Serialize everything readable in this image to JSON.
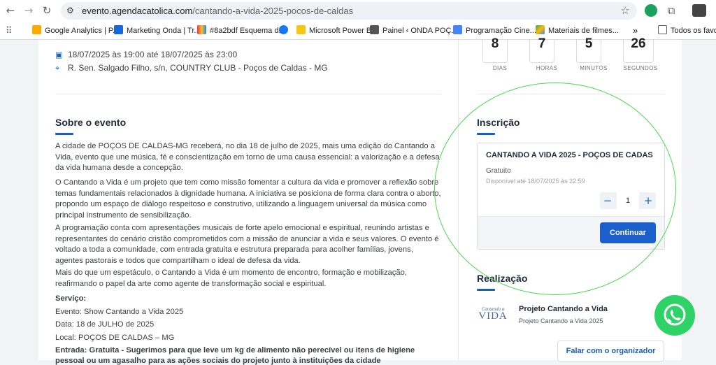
{
  "browser": {
    "url_host": "evento.agendacatolica.com",
    "url_path": "/cantando-a-vida-2025-pocos-de-caldas",
    "bookmarks": [
      {
        "label": "Google Analytics | P...",
        "icon": "analytics-icon",
        "color": "#f9ab00"
      },
      {
        "label": "Marketing Onda | Tr...",
        "icon": "trello-icon",
        "color": "#1868db"
      },
      {
        "label": "#8a2bdf Esquema d...",
        "icon": "palette-icon",
        "color": "#8a2bdf"
      },
      {
        "label": "",
        "icon": "facebook-icon",
        "color": "#1877f2"
      },
      {
        "label": "Microsoft Power BI",
        "icon": "powerbi-icon",
        "color": "#f2c811"
      },
      {
        "label": "Painel ‹ ONDA POÇ...",
        "icon": "wordpress-icon",
        "color": "#555555"
      },
      {
        "label": "Programação Cine...",
        "icon": "docs-icon",
        "color": "#4285f4"
      },
      {
        "label": "Materiais de filmes...",
        "icon": "drive-icon",
        "color": "#34a853"
      }
    ],
    "more_label": "»",
    "other_bookmarks": "Todos os favorit"
  },
  "event": {
    "datetime": "18/07/2025 às 19:00 até 18/07/2025 às 23:00",
    "address": "R. Sen. Salgado Filho, s/n, COUNTRY CLUB - Poços de Caldas - MG"
  },
  "about": {
    "title": "Sobre o evento",
    "p1": "A cidade de POÇOS DE CALDAS-MG receberá, no dia 18 de julho de 2025, mais uma edição do Cantando a Vida, evento que une música, fé e conscientização em torno de uma causa essencial: a valorização e a defesa da vida humana desde a concepção.",
    "p2": "O Cantando a Vida é um projeto que tem como missão fomentar a cultura da vida e promover a reflexão sobre temas fundamentais relacionados à dignidade humana. A iniciativa se posiciona de forma clara contra o aborto, propondo um espaço de diálogo respeitoso e construtivo, utilizando a linguagem universal da música como principal instrumento de sensibilização.",
    "p3": "A programação conta com apresentações musicais de forte apelo emocional e espiritual, reunindo artistas e representantes do cenário cristão comprometidos com a missão de anunciar a vida e seus valores. O evento é voltado a toda a comunidade, com entrada gratuita e estrutura preparada para acolher famílias, jovens, agentes pastorais e todos que compartilham o ideal de defesa da vida.",
    "p4": "Mais do que um espetáculo, o Cantando a Vida é um momento de encontro, formação e mobilização, reafirmando o papel da arte como agente de transformação social e espiritual.",
    "servico": "Serviço:",
    "evento": "Evento: Show Cantando a Vida 2025",
    "data": "Data: 18 de JULHO de 2025",
    "local": "Local: POÇOS DE CALDAS – MG",
    "entrada": "Entrada: Gratuita - Sugerimos para que leve um kg de alimento não perecível ou itens de higiene",
    "entrada_cont": "pessoal ou um agasalho para as ações sociais do projeto junto à instituições da cidade"
  },
  "countdown": [
    {
      "value": "8",
      "label": "DIAS"
    },
    {
      "value": "7",
      "label": "HORAS"
    },
    {
      "value": "5",
      "label": "MINUTOS"
    },
    {
      "value": "26",
      "label": "SEGUNDOS"
    }
  ],
  "registration": {
    "title": "Inscrição",
    "ticket_name": "CANTANDO A VIDA 2025 - POÇOS DE CADAS",
    "price": "Gratuito",
    "available": "Disponível até 18/07/2025 às 22:59",
    "quantity": "1",
    "minus": "−",
    "plus": "+",
    "continue_label": "Continuar"
  },
  "organizer": {
    "title": "Realização",
    "logo_small": "Cantando a",
    "logo_big": "VIDA",
    "name": "Projeto Cantando a Vida",
    "subtitle": "Projeto Cantando a Vida 2025",
    "contact_label": "Falar com o organizador"
  },
  "colors": {
    "accent": "#1a5fcc",
    "whatsapp": "#2fd266",
    "annotation": "#4cd94c"
  }
}
